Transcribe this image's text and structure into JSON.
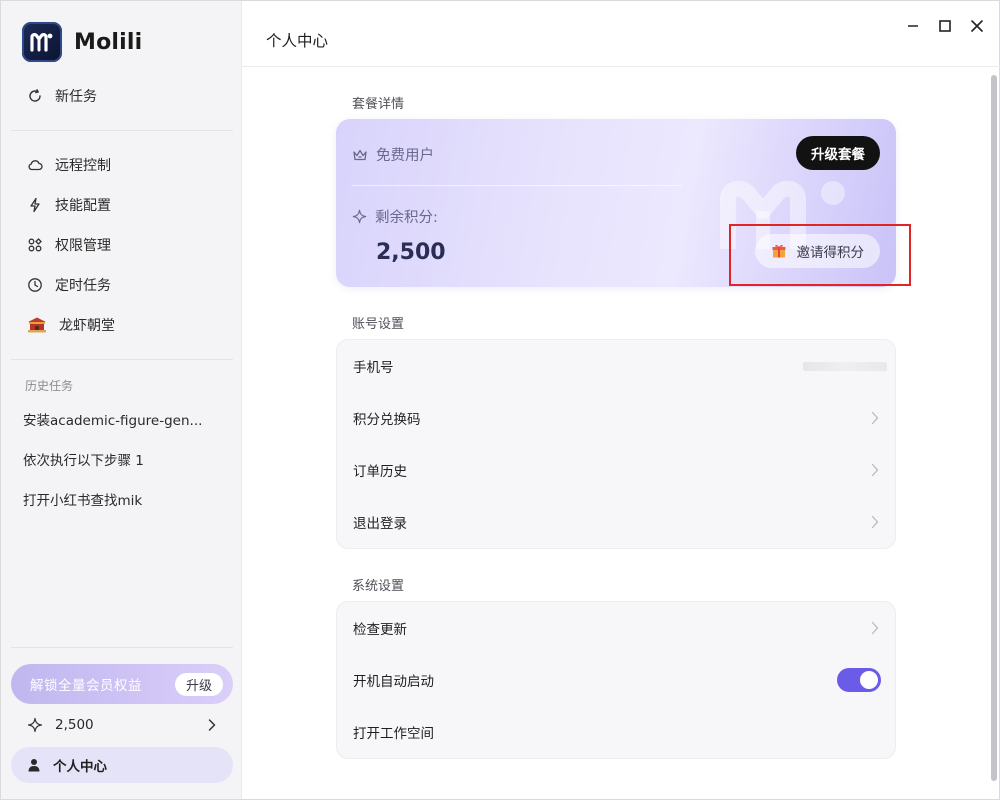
{
  "app": {
    "name": "Molili",
    "page_title": "个人中心"
  },
  "sidebar": {
    "new_task": "新任务",
    "nav": [
      {
        "label": "远程控制",
        "icon": "cloud-icon"
      },
      {
        "label": "技能配置",
        "icon": "lightning-icon"
      },
      {
        "label": "权限管理",
        "icon": "grid-icon"
      },
      {
        "label": "定时任务",
        "icon": "clock-icon"
      },
      {
        "label": "龙虾朝堂",
        "icon": "palace-icon"
      }
    ],
    "history_label": "历史任务",
    "history": [
      "安装academic-figure-gen...",
      "依次执行以下步骤 1",
      "打开小红书查找mik"
    ],
    "upgrade_banner": {
      "text": "解锁全量会员权益",
      "button": "升级"
    },
    "points": "2,500",
    "profile": "个人中心"
  },
  "plan": {
    "section": "套餐详情",
    "tier": "免费用户",
    "upgrade_button": "升级套餐",
    "points_label": "剩余积分:",
    "points_value": "2,500",
    "invite_button": "邀请得积分"
  },
  "account": {
    "section": "账号设置",
    "rows": [
      "手机号",
      "积分兑换码",
      "订单历史",
      "退出登录"
    ]
  },
  "system": {
    "section": "系统设置",
    "rows": [
      "检查更新",
      "开机自动启动",
      "打开工作空间"
    ],
    "auto_start_enabled": true
  },
  "colors": {
    "accent": "#6b5ce7",
    "highlight": "#e02525",
    "sidebar_bg": "#f4f4f6"
  }
}
